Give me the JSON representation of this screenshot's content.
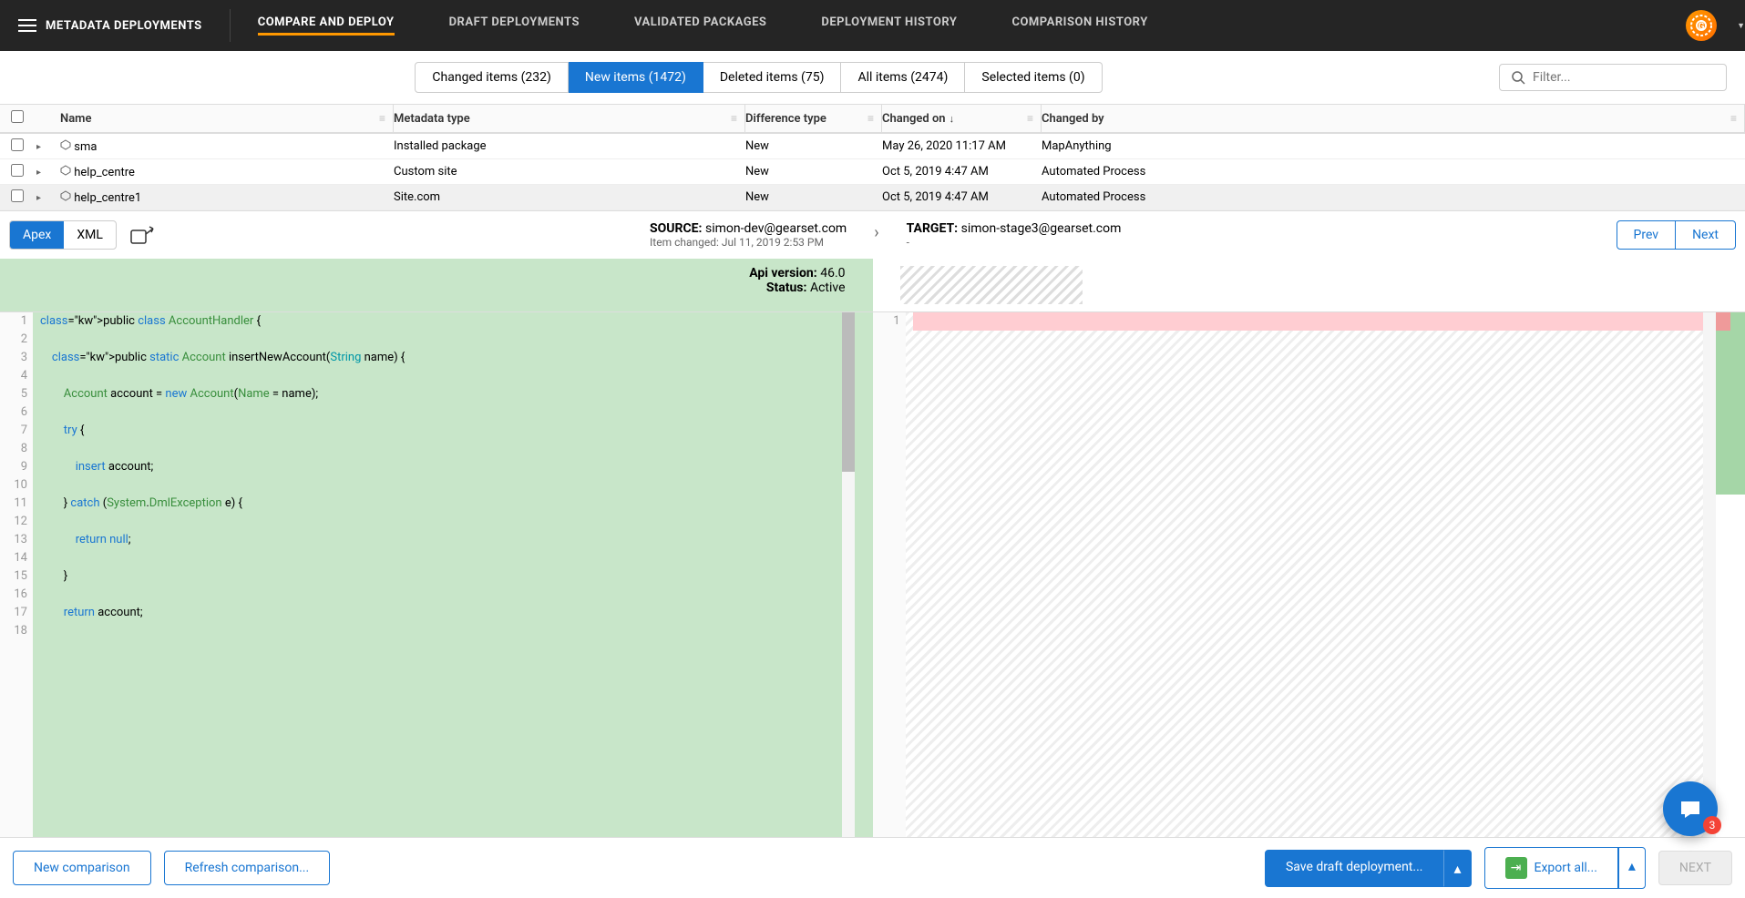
{
  "header": {
    "title": "METADATA DEPLOYMENTS",
    "tabs": [
      "COMPARE AND DEPLOY",
      "DRAFT DEPLOYMENTS",
      "VALIDATED PACKAGES",
      "DEPLOYMENT HISTORY",
      "COMPARISON HISTORY"
    ],
    "avatar_letter": "G"
  },
  "filters": {
    "pills": [
      "Changed items (232)",
      "New items (1472)",
      "Deleted items (75)",
      "All items (2474)",
      "Selected items (0)"
    ],
    "active_index": 1,
    "search_placeholder": "Filter..."
  },
  "table": {
    "columns": [
      "Name",
      "Metadata type",
      "Difference type",
      "Changed on",
      "Changed by"
    ],
    "sort_col": "Changed on",
    "rows": [
      {
        "name": "sma",
        "metadata_type": "Installed package",
        "diff_type": "New",
        "changed_on": "May 26, 2020 11:17 AM",
        "changed_by": "MapAnything"
      },
      {
        "name": "help_centre",
        "metadata_type": "Custom site",
        "diff_type": "New",
        "changed_on": "Oct 5, 2019 4:47 AM",
        "changed_by": "Automated Process"
      },
      {
        "name": "help_centre1",
        "metadata_type": "Site.com",
        "diff_type": "New",
        "changed_on": "Oct 5, 2019 4:47 AM",
        "changed_by": "Automated Process"
      }
    ]
  },
  "diff": {
    "view_tabs": [
      "Apex",
      "XML"
    ],
    "source_label": "SOURCE:",
    "source_value": "simon-dev@gearset.com",
    "source_sub": "Item changed: Jul 11, 2019 2:53 PM",
    "target_label": "TARGET:",
    "target_value": "simon-stage3@gearset.com",
    "target_sub": "-",
    "prev": "Prev",
    "next": "Next",
    "api_version_label": "Api version:",
    "api_version": "46.0",
    "status_label": "Status:",
    "status": "Active"
  },
  "code": {
    "lines": [
      "public class AccountHandler {",
      "",
      "    public static Account insertNewAccount(String name) {",
      "",
      "        Account account = new Account(Name = name);",
      "",
      "        try {",
      "",
      "            insert account;",
      "",
      "        } catch (System.DmlException e) {",
      "",
      "            return null;",
      "",
      "        }",
      "",
      "        return account;",
      ""
    ]
  },
  "footer": {
    "new_comparison": "New comparison",
    "refresh": "Refresh comparison...",
    "save_draft": "Save draft deployment...",
    "export": "Export all...",
    "next": "NEXT"
  },
  "chat": {
    "badge": "3"
  }
}
